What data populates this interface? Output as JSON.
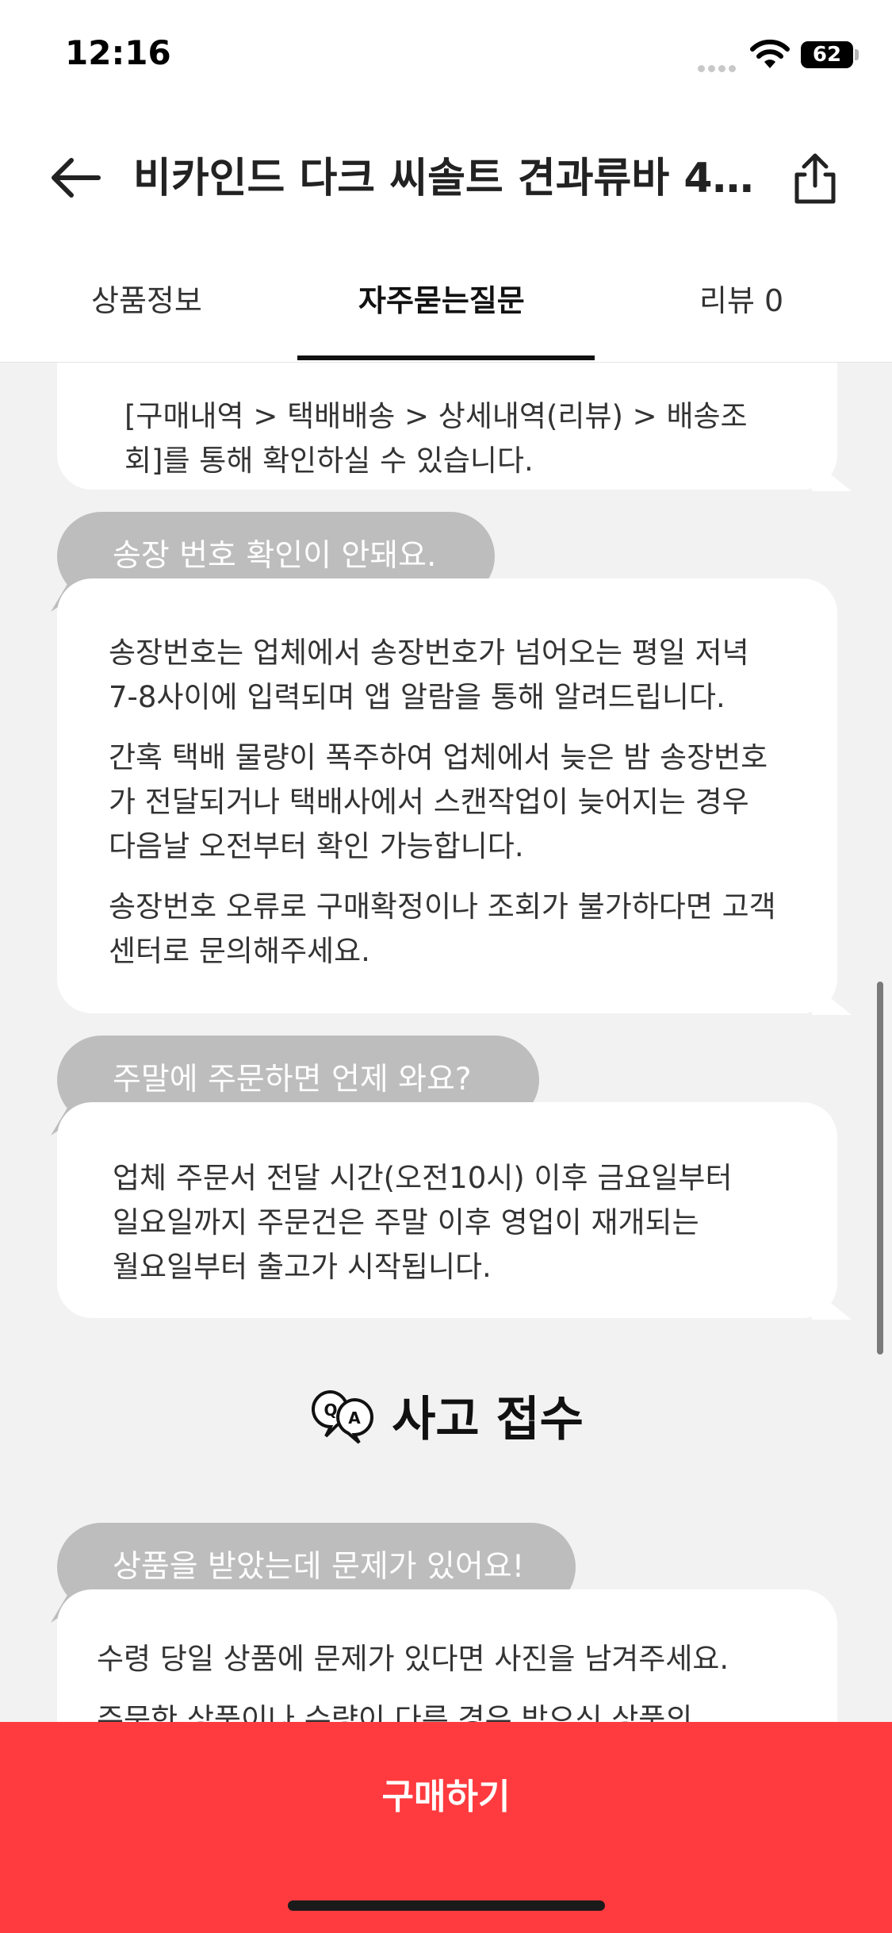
{
  "status_bar": {
    "time": "12:16",
    "battery": "62"
  },
  "header": {
    "title": "비카인드 다크 씨솔트 견과류바 40...",
    "back_icon": "arrow-left-icon",
    "share_icon": "share-icon"
  },
  "tabs": [
    {
      "label": "상품정보",
      "active": false
    },
    {
      "label": "자주묻는질문",
      "active": true
    },
    {
      "label": "리뷰 0",
      "active": false
    }
  ],
  "faq": [
    {
      "answer": [
        "[구매내역 > 택배배송 > 상세내역(리뷰) > 배송조회]를 통해 확인하실 수 있습니다."
      ]
    },
    {
      "question": "송장 번호 확인이 안돼요.",
      "answer": [
        "송장번호는 업체에서 송장번호가 넘어오는 평일 저녁 7-8사이에 입력되며 앱 알람을 통해 알려드립니다.",
        "간혹 택배 물량이 폭주하여 업체에서 늦은 밤 송장번호가 전달되거나 택배사에서 스캔작업이 늦어지는 경우 다음날 오전부터 확인 가능합니다.",
        "송장번호 오류로 구매확정이나 조회가 불가하다면 고객센터로 문의해주세요."
      ]
    },
    {
      "question": "주말에 주문하면 언제 와요?",
      "answer": [
        "업체 주문서 전달 시간(오전10시) 이후 금요일부터 일요일까지 주문건은 주말 이후 영업이 재개되는 월요일부터 출고가 시작됩니다."
      ]
    }
  ],
  "section": {
    "icon": "qa-chat-icon",
    "title": "사고 접수"
  },
  "accident": {
    "question": "상품을 받았는데 문제가 있어요!",
    "answer": [
      "수령 당일 상품에 문제가 있다면 사진을 남겨주세요.",
      "주문한 상품이나 수량이 다른 경우 받으신 상품의"
    ]
  },
  "footer": {
    "buy_label": "구매하기"
  },
  "colors": {
    "accent": "#ff3b3f",
    "question_bubble": "#bdbdbd",
    "page_background": "#f2f2f2"
  }
}
